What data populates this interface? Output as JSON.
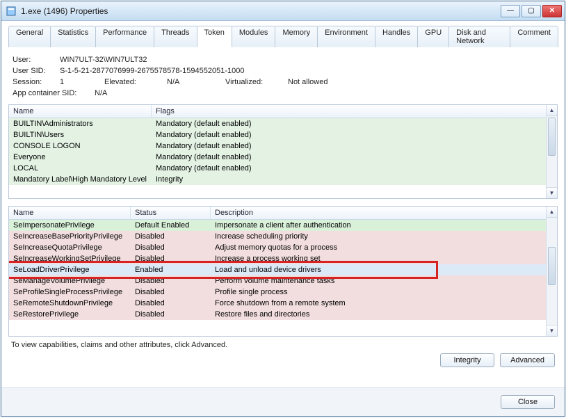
{
  "window": {
    "title": "1.exe (1496) Properties"
  },
  "win_buttons": {
    "minimize": "—",
    "maximize": "▢",
    "close": "✕"
  },
  "tabs": [
    "General",
    "Statistics",
    "Performance",
    "Threads",
    "Token",
    "Modules",
    "Memory",
    "Environment",
    "Handles",
    "GPU",
    "Disk and Network",
    "Comment"
  ],
  "active_tab_index": 4,
  "token_info": {
    "user_label": "User:",
    "user_value": "WIN7ULT-32\\WIN7ULT32",
    "sid_label": "User SID:",
    "sid_value": "S-1-5-21-2877076999-2675578578-1594552051-1000",
    "session_label": "Session:",
    "session_value": "1",
    "elevated_label": "Elevated:",
    "elevated_value": "N/A",
    "virtualized_label": "Virtualized:",
    "virtualized_value": "Not allowed",
    "appcontainer_label": "App container SID:",
    "appcontainer_value": "N/A"
  },
  "groups": {
    "headers": {
      "name": "Name",
      "flags": "Flags"
    },
    "rows": [
      {
        "name": "BUILTIN\\Administrators",
        "flags": "Mandatory (default enabled)"
      },
      {
        "name": "BUILTIN\\Users",
        "flags": "Mandatory (default enabled)"
      },
      {
        "name": "CONSOLE LOGON",
        "flags": "Mandatory (default enabled)"
      },
      {
        "name": "Everyone",
        "flags": "Mandatory (default enabled)"
      },
      {
        "name": "LOCAL",
        "flags": "Mandatory (default enabled)"
      },
      {
        "name": "Mandatory Label\\High Mandatory Level",
        "flags": "Integrity"
      }
    ]
  },
  "privileges": {
    "headers": {
      "name": "Name",
      "status": "Status",
      "desc": "Description"
    },
    "rows": [
      {
        "name": "SeImpersonatePrivilege",
        "status": "Default Enabled",
        "desc": "Impersonate a client after authentication",
        "cls": "green-row"
      },
      {
        "name": "SeIncreaseBasePriorityPrivilege",
        "status": "Disabled",
        "desc": "Increase scheduling priority",
        "cls": "pink-row"
      },
      {
        "name": "SeIncreaseQuotaPrivilege",
        "status": "Disabled",
        "desc": "Adjust memory quotas for a process",
        "cls": "pink-row"
      },
      {
        "name": "SeIncreaseWorkingSetPrivilege",
        "status": "Disabled",
        "desc": "Increase a process working set",
        "cls": "pink-row"
      },
      {
        "name": "SeLoadDriverPrivilege",
        "status": "Enabled",
        "desc": "Load and unload device drivers",
        "cls": "blue-row"
      },
      {
        "name": "SeManageVolumePrivilege",
        "status": "Disabled",
        "desc": "Perform volume maintenance tasks",
        "cls": "pink-row"
      },
      {
        "name": "SeProfileSingleProcessPrivilege",
        "status": "Disabled",
        "desc": "Profile single process",
        "cls": "pink-row"
      },
      {
        "name": "SeRemoteShutdownPrivilege",
        "status": "Disabled",
        "desc": "Force shutdown from a remote system",
        "cls": "pink-row"
      },
      {
        "name": "SeRestorePrivilege",
        "status": "Disabled",
        "desc": "Restore files and directories",
        "cls": "pink-row"
      }
    ],
    "highlight_index": 4
  },
  "hint_text": "To view capabilities, claims and other attributes, click Advanced.",
  "buttons": {
    "integrity": "Integrity",
    "advanced": "Advanced",
    "close": "Close"
  }
}
